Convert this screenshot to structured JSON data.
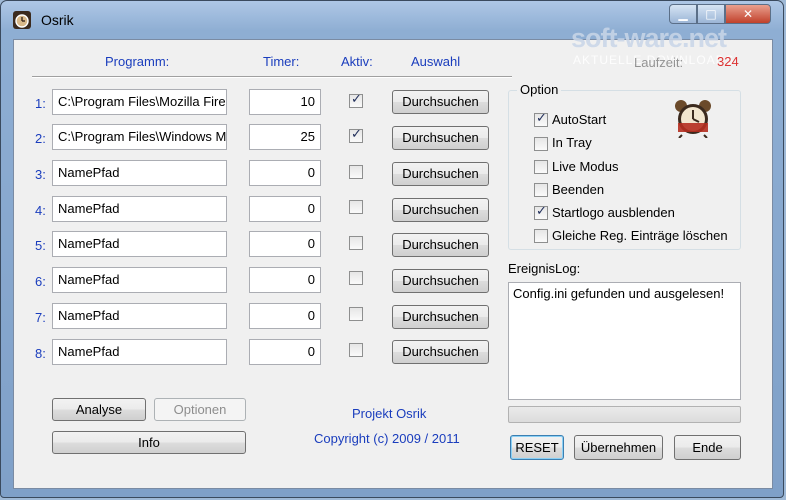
{
  "window": {
    "title": "Osrik",
    "buttons": {
      "minimize": "▁",
      "maximize": "□",
      "close": "✕"
    }
  },
  "watermark": {
    "brand": "soft-ware.net",
    "subtitle": "AKTUELLE DOWNLOADS",
    "count": "324",
    "behind_text": "Laufzeit:"
  },
  "headers": {
    "program": "Programm:",
    "timer": "Timer:",
    "active": "Aktiv:",
    "select": "Auswahl"
  },
  "rows": [
    {
      "num": "1:",
      "path": "C:\\Program Files\\Mozilla Fire",
      "timer": "10",
      "checked": true,
      "browse": "Durchsuchen"
    },
    {
      "num": "2:",
      "path": "C:\\Program Files\\Windows M",
      "timer": "25",
      "checked": true,
      "browse": "Durchsuchen"
    },
    {
      "num": "3:",
      "path": "NamePfad",
      "timer": "0",
      "checked": false,
      "browse": "Durchsuchen"
    },
    {
      "num": "4:",
      "path": "NamePfad",
      "timer": "0",
      "checked": false,
      "browse": "Durchsuchen"
    },
    {
      "num": "5:",
      "path": "NamePfad",
      "timer": "0",
      "checked": false,
      "browse": "Durchsuchen"
    },
    {
      "num": "6:",
      "path": "NamePfad",
      "timer": "0",
      "checked": false,
      "browse": "Durchsuchen"
    },
    {
      "num": "7:",
      "path": "NamePfad",
      "timer": "0",
      "checked": false,
      "browse": "Durchsuchen"
    },
    {
      "num": "8:",
      "path": "NamePfad",
      "timer": "0",
      "checked": false,
      "browse": "Durchsuchen"
    }
  ],
  "options": {
    "label": "Option",
    "items": [
      {
        "label": "AutoStart",
        "checked": true
      },
      {
        "label": "In Tray",
        "checked": false
      },
      {
        "label": "Live Modus",
        "checked": false
      },
      {
        "label": "Beenden",
        "checked": false
      },
      {
        "label": "Startlogo ausblenden",
        "checked": true
      },
      {
        "label": "Gleiche Reg. Einträge löschen",
        "checked": false
      }
    ]
  },
  "log": {
    "label": "EreignisLog:",
    "text": "Config.ini gefunden und ausgelesen!"
  },
  "progress": {
    "value": 0
  },
  "buttons": {
    "analyse": "Analyse",
    "options": "Optionen",
    "info": "Info",
    "reset": "RESET",
    "apply": "Übernehmen",
    "end": "Ende"
  },
  "footer": {
    "project": "Projekt Osrik",
    "copyright": "Copyright (c) 2009 / 2011"
  },
  "colors": {
    "accent_text": "#1a3dbd",
    "title_bar": "#8eaed3",
    "close_button": "#c1412b"
  },
  "icons": {
    "app": "alarm-clock-icon",
    "logo": "alarm-clock-icon",
    "check": "checkmark-icon"
  }
}
